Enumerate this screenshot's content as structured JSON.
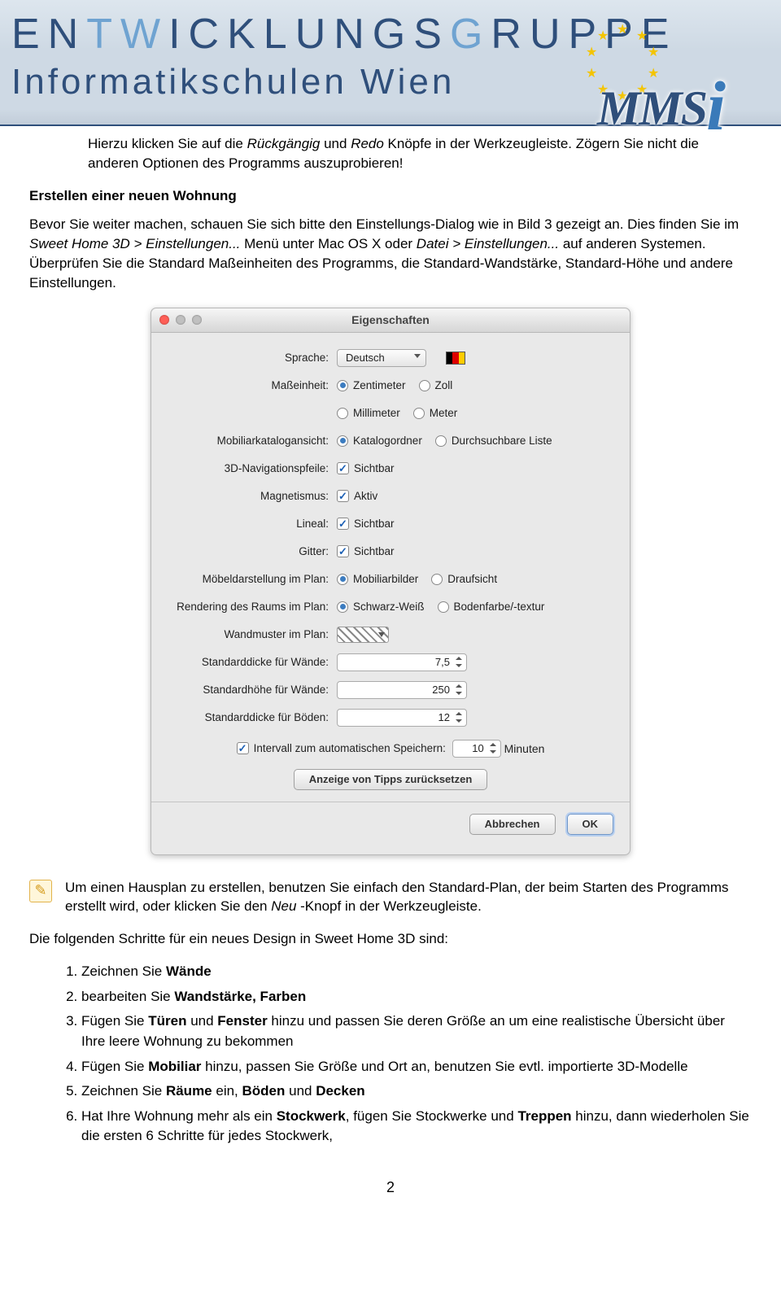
{
  "banner": {
    "line1_pre": "EN",
    "line1_hi1": "TW",
    "line1_mid": "ICKLUNGS",
    "line1_hi2": "G",
    "line1_end": "RUPPE",
    "line2": "Informatikschulen Wien",
    "logo_text": "MMS"
  },
  "intro_indent": {
    "pre": "Hierzu klicken Sie auf die ",
    "it1": "Rückgängig",
    "mid1": " und ",
    "it2": "Redo",
    "post": " Knöpfe in der Werkzeugleiste. Zögern Sie nicht die anderen Optionen des Programms auszuprobieren!"
  },
  "section_head": "Erstellen einer neuen Wohnung",
  "para2": {
    "a": "Bevor Sie weiter machen, schauen Sie sich bitte den Einstellungs-Dialog wie in Bild 3 gezeigt an. Dies finden Sie im ",
    "it1": "Sweet Home 3D > Einstellungen...",
    "b": " Menü unter Mac OS X oder ",
    "it2": "Datei > Einstellungen...",
    "c": " auf anderen Systemen. Überprüfen Sie die Standard Maßeinheiten des Programms, die Standard-Wandstärke, Standard-Höhe und andere Einstellungen."
  },
  "dialog": {
    "title": "Eigenschaften",
    "rows": {
      "sprache": {
        "label": "Sprache:",
        "value": "Deutsch"
      },
      "masseinheit": {
        "label": "Maßeinheit:",
        "opts": [
          "Zentimeter",
          "Zoll",
          "Millimeter",
          "Meter"
        ],
        "selected": 0
      },
      "katalog": {
        "label": "Mobiliarkatalogansicht:",
        "opts": [
          "Katalogordner",
          "Durchsuchbare Liste"
        ],
        "selected": 0
      },
      "nav": {
        "label": "3D-Navigationspfeile:",
        "opt": "Sichtbar",
        "checked": true
      },
      "magnet": {
        "label": "Magnetismus:",
        "opt": "Aktiv",
        "checked": true
      },
      "lineal": {
        "label": "Lineal:",
        "opt": "Sichtbar",
        "checked": true
      },
      "gitter": {
        "label": "Gitter:",
        "opt": "Sichtbar",
        "checked": true
      },
      "moebel": {
        "label": "Möbeldarstellung im Plan:",
        "opts": [
          "Mobiliarbilder",
          "Draufsicht"
        ],
        "selected": 0
      },
      "render": {
        "label": "Rendering des Raums im Plan:",
        "opts": [
          "Schwarz-Weiß",
          "Bodenfarbe/-textur"
        ],
        "selected": 0
      },
      "wandmuster": {
        "label": "Wandmuster im Plan:"
      },
      "dicke_wand": {
        "label": "Standarddicke für Wände:",
        "value": "7,5"
      },
      "hoehe_wand": {
        "label": "Standardhöhe für Wände:",
        "value": "250"
      },
      "dicke_boden": {
        "label": "Standarddicke für Böden:",
        "value": "12"
      },
      "interval": {
        "label": "Intervall zum automatischen Speichern:",
        "value": "10",
        "unit": "Minuten",
        "checked": true
      },
      "reset": "Anzeige von Tipps zurücksetzen",
      "cancel": "Abbrechen",
      "ok": "OK"
    }
  },
  "tip": {
    "a": "Um einen Hausplan zu erstellen, benutzen Sie einfach den Standard-Plan, der beim Starten des Programms erstellt wird, oder klicken Sie den ",
    "it": "Neu",
    "b": " -Knopf in der Werkzeugleiste."
  },
  "para3": "Die folgenden Schritte für ein neues Design in Sweet Home 3D sind:",
  "steps_pre": {
    "s1a": "Zeichnen Sie ",
    "s1b": "Wände",
    "s2a": "bearbeiten Sie ",
    "s2b": "Wandstärke, Farben",
    "s3a": "Fügen Sie ",
    "s3b": "Türen",
    "s3c": " und ",
    "s3d": "Fenster",
    "s3e": " hinzu und passen Sie deren Größe an um eine realistische Übersicht über Ihre leere Wohnung zu bekommen",
    "s4a": "Fügen Sie ",
    "s4b": "Mobiliar",
    "s4c": " hinzu, passen Sie Größe und Ort an, benutzen Sie evtl. importierte 3D-Modelle",
    "s5a": "Zeichnen Sie ",
    "s5b": "Räume",
    "s5c": " ein, ",
    "s5d": "Böden",
    "s5e": " und ",
    "s5f": "Decken",
    "s6a": "Hat Ihre Wohnung mehr als ein ",
    "s6b": "Stockwerk",
    "s6c": ", fügen Sie Stockwerke und ",
    "s6d": "Treppen",
    "s6e": " hinzu, dann wiederholen Sie die ersten 6 Schritte für jedes Stockwerk,"
  },
  "page_number": "2"
}
